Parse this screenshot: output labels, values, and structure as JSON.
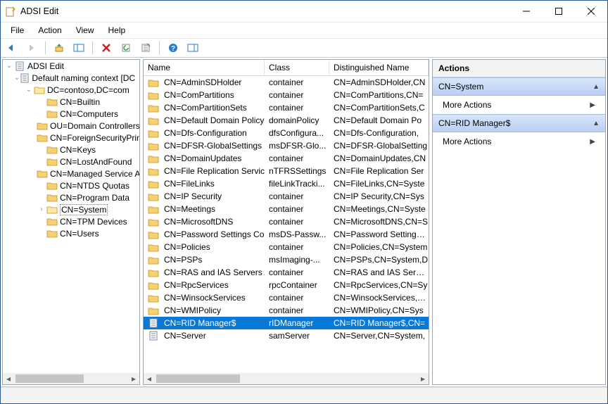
{
  "window": {
    "title": "ADSI Edit"
  },
  "menu": {
    "file": "File",
    "action": "Action",
    "view": "View",
    "help": "Help"
  },
  "tree": {
    "root": "ADSI Edit",
    "context": "Default naming context [DC",
    "domain": "DC=contoso,DC=com",
    "nodes": [
      "CN=Builtin",
      "CN=Computers",
      "OU=Domain Controllers",
      "CN=ForeignSecurityPrincipals",
      "CN=Keys",
      "CN=LostAndFound",
      "CN=Managed Service Accounts",
      "CN=NTDS Quotas",
      "CN=Program Data",
      "CN=System",
      "CN=TPM Devices",
      "CN=Users"
    ],
    "selected": "CN=System"
  },
  "columns": {
    "name": "Name",
    "class": "Class",
    "dn": "Distinguished Name"
  },
  "rows": [
    {
      "name": "CN=AdminSDHolder",
      "class": "container",
      "dn": "CN=AdminSDHolder,CN"
    },
    {
      "name": "CN=ComPartitions",
      "class": "container",
      "dn": "CN=ComPartitions,CN="
    },
    {
      "name": "CN=ComPartitionSets",
      "class": "container",
      "dn": "CN=ComPartitionSets,C"
    },
    {
      "name": "CN=Default Domain Policy",
      "class": "domainPolicy",
      "dn": "CN=Default Domain Po"
    },
    {
      "name": "CN=Dfs-Configuration",
      "class": "dfsConfigura...",
      "dn": "CN=Dfs-Configuration,"
    },
    {
      "name": "CN=DFSR-GlobalSettings",
      "class": "msDFSR-Glo...",
      "dn": "CN=DFSR-GlobalSetting"
    },
    {
      "name": "CN=DomainUpdates",
      "class": "container",
      "dn": "CN=DomainUpdates,CN"
    },
    {
      "name": "CN=File Replication Service",
      "class": "nTFRSSettings",
      "dn": "CN=File Replication Ser"
    },
    {
      "name": "CN=FileLinks",
      "class": "fileLinkTracki...",
      "dn": "CN=FileLinks,CN=Syste"
    },
    {
      "name": "CN=IP Security",
      "class": "container",
      "dn": "CN=IP Security,CN=Sys"
    },
    {
      "name": "CN=Meetings",
      "class": "container",
      "dn": "CN=Meetings,CN=Syste"
    },
    {
      "name": "CN=MicrosoftDNS",
      "class": "container",
      "dn": "CN=MicrosoftDNS,CN=S"
    },
    {
      "name": "CN=Password Settings Con...",
      "class": "msDS-Passw...",
      "dn": "CN=Password Settings C"
    },
    {
      "name": "CN=Policies",
      "class": "container",
      "dn": "CN=Policies,CN=System"
    },
    {
      "name": "CN=PSPs",
      "class": "msImaging-...",
      "dn": "CN=PSPs,CN=System,D"
    },
    {
      "name": "CN=RAS and IAS Servers Ac...",
      "class": "container",
      "dn": "CN=RAS and IAS Servers"
    },
    {
      "name": "CN=RpcServices",
      "class": "rpcContainer",
      "dn": "CN=RpcServices,CN=Sy"
    },
    {
      "name": "CN=WinsockServices",
      "class": "container",
      "dn": "CN=WinsockServices,CN"
    },
    {
      "name": "CN=WMIPolicy",
      "class": "container",
      "dn": "CN=WMIPolicy,CN=Sys"
    },
    {
      "name": "CN=RID Manager$",
      "class": "rIDManager",
      "dn": "CN=RID Manager$,CN=",
      "selected": true,
      "icon": "obj"
    },
    {
      "name": "CN=Server",
      "class": "samServer",
      "dn": "CN=Server,CN=System,",
      "icon": "obj"
    }
  ],
  "actions": {
    "title": "Actions",
    "sec1": "CN=System",
    "more1": "More Actions",
    "sec2": "CN=RID Manager$",
    "more2": "More Actions"
  }
}
